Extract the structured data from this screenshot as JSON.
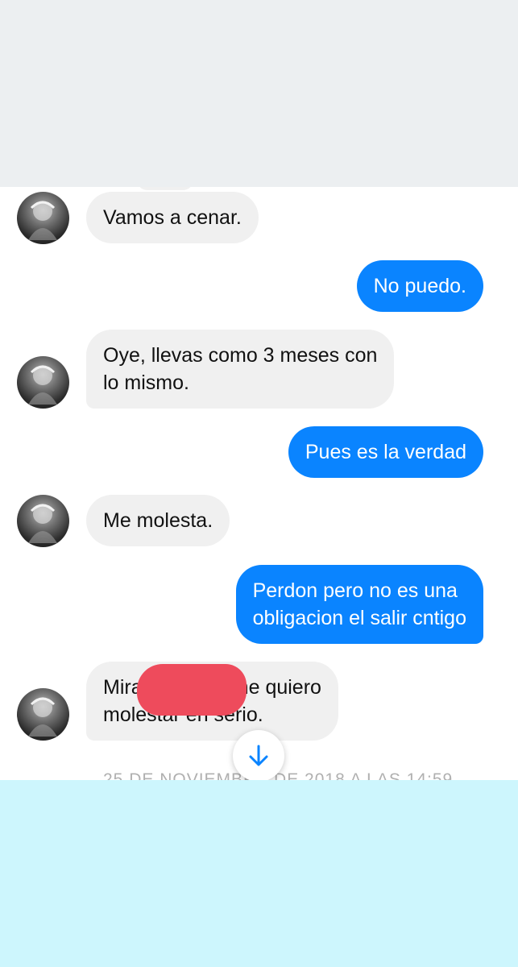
{
  "messages": [
    {
      "direction": "in",
      "text": "Vamos a cenar."
    },
    {
      "direction": "out",
      "text": "No puedo."
    },
    {
      "direction": "in",
      "text": "Oye, llevas como 3 meses con\nlo mismo."
    },
    {
      "direction": "out",
      "text": "Pues es la verdad"
    },
    {
      "direction": "in",
      "text": "Me molesta."
    },
    {
      "direction": "out",
      "text": "Perdon pero no es una\nobligacion el salir cntigo"
    },
    {
      "direction": "in",
      "text": "Mira           no me quiero\nmolestar en serio."
    }
  ],
  "timestamp": "25 DE NOVIEMBRE DE 2018 A LAS 14:59",
  "scroll_button": {
    "icon": "arrow-down-icon"
  },
  "colors": {
    "incoming_bubble": "#f0f0f0",
    "outgoing_bubble": "#0a84ff",
    "redaction": "#ee4b5c",
    "top_band": "#eceff1",
    "bottom_band": "#cdf6fd"
  }
}
